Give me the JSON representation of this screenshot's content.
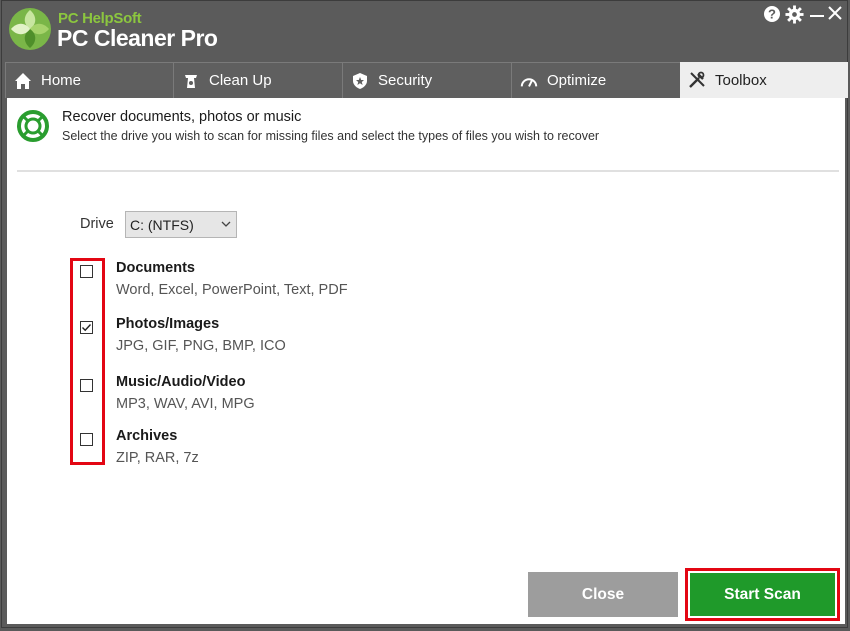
{
  "app": {
    "brand_small": "PC HelpSoft",
    "brand_big": "PC Cleaner Pro"
  },
  "titlebar": {
    "help_icon": "help-icon",
    "settings_icon": "gear-icon",
    "minimize_icon": "minimize-icon",
    "close_icon": "close-icon"
  },
  "tabs": [
    {
      "label": "Home",
      "icon": "home-icon",
      "active": false
    },
    {
      "label": "Clean Up",
      "icon": "clean-up-icon",
      "active": false
    },
    {
      "label": "Security",
      "icon": "shield-icon",
      "active": false
    },
    {
      "label": "Optimize",
      "icon": "speedometer-icon",
      "active": false
    },
    {
      "label": "Toolbox",
      "icon": "tools-icon",
      "active": true
    }
  ],
  "header": {
    "title": "Recover documents, photos or music",
    "subtitle": "Select the drive you wish to scan for missing files and select the types of files you wish to recover",
    "icon": "lifebuoy-icon"
  },
  "drive": {
    "label": "Drive",
    "selected": "C: (NTFS)"
  },
  "options": [
    {
      "title": "Documents",
      "desc": "Word, Excel, PowerPoint, Text, PDF",
      "checked": false
    },
    {
      "title": "Photos/Images",
      "desc": "JPG, GIF, PNG, BMP, ICO",
      "checked": true
    },
    {
      "title": "Music/Audio/Video",
      "desc": "MP3, WAV, AVI, MPG",
      "checked": false
    },
    {
      "title": "Archives",
      "desc": "ZIP, RAR, 7z",
      "checked": false
    }
  ],
  "buttons": {
    "close": "Close",
    "start_scan": "Start Scan"
  },
  "colors": {
    "accent_green": "#1f9a2a",
    "highlight_red": "#e30613",
    "brand_green": "#8cc63f"
  }
}
